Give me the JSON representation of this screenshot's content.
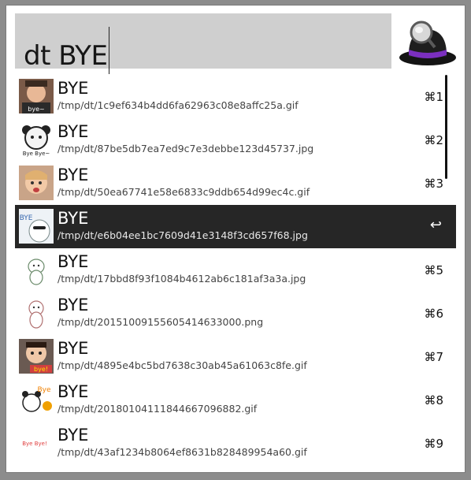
{
  "search": {
    "query": "dt BYE"
  },
  "app": {
    "icon": "alfred-hat-icon"
  },
  "results": [
    {
      "title": "BYE",
      "path": "/tmp/dt/1c9ef634b4dd6fa62963c08e8affc25a.gif",
      "shortcut": "⌘1"
    },
    {
      "title": "BYE",
      "path": "/tmp/dt/87be5db7ea7ed9c7e3debbe123d45737.jpg",
      "shortcut": "⌘2"
    },
    {
      "title": "BYE",
      "path": "/tmp/dt/50ea67741e58e6833c9ddb654d99ec4c.gif",
      "shortcut": "⌘3"
    },
    {
      "title": "BYE",
      "path": "/tmp/dt/e6b04ee1bc7609d41e3148f3cd657f68.jpg",
      "shortcut": "↩",
      "selected": true
    },
    {
      "title": "BYE",
      "path": "/tmp/dt/17bbd8f93f1084b4612ab6c181af3a3a.jpg",
      "shortcut": "⌘5"
    },
    {
      "title": "BYE",
      "path": "/tmp/dt/20151009155605414633000.png",
      "shortcut": "⌘6"
    },
    {
      "title": "BYE",
      "path": "/tmp/dt/4895e4bc5bd7638c30ab45a61063c8fe.gif",
      "shortcut": "⌘7"
    },
    {
      "title": "BYE",
      "path": "/tmp/dt/20180104111844667096882.gif",
      "shortcut": "⌘8"
    },
    {
      "title": "BYE",
      "path": "/tmp/dt/43af1234b8064ef8631b828489954a60.gif",
      "shortcut": "⌘9"
    }
  ],
  "thumbnails": {
    "t1": "bye~",
    "t2": "Bye Bye~",
    "t4": "BYE",
    "t7": "bye!",
    "t8": "Bye",
    "t9": "Bye Bye!"
  },
  "colors": {
    "selection": "#262626",
    "search_bg": "#cfcfcf",
    "hat_band": "#7b2fbf"
  }
}
